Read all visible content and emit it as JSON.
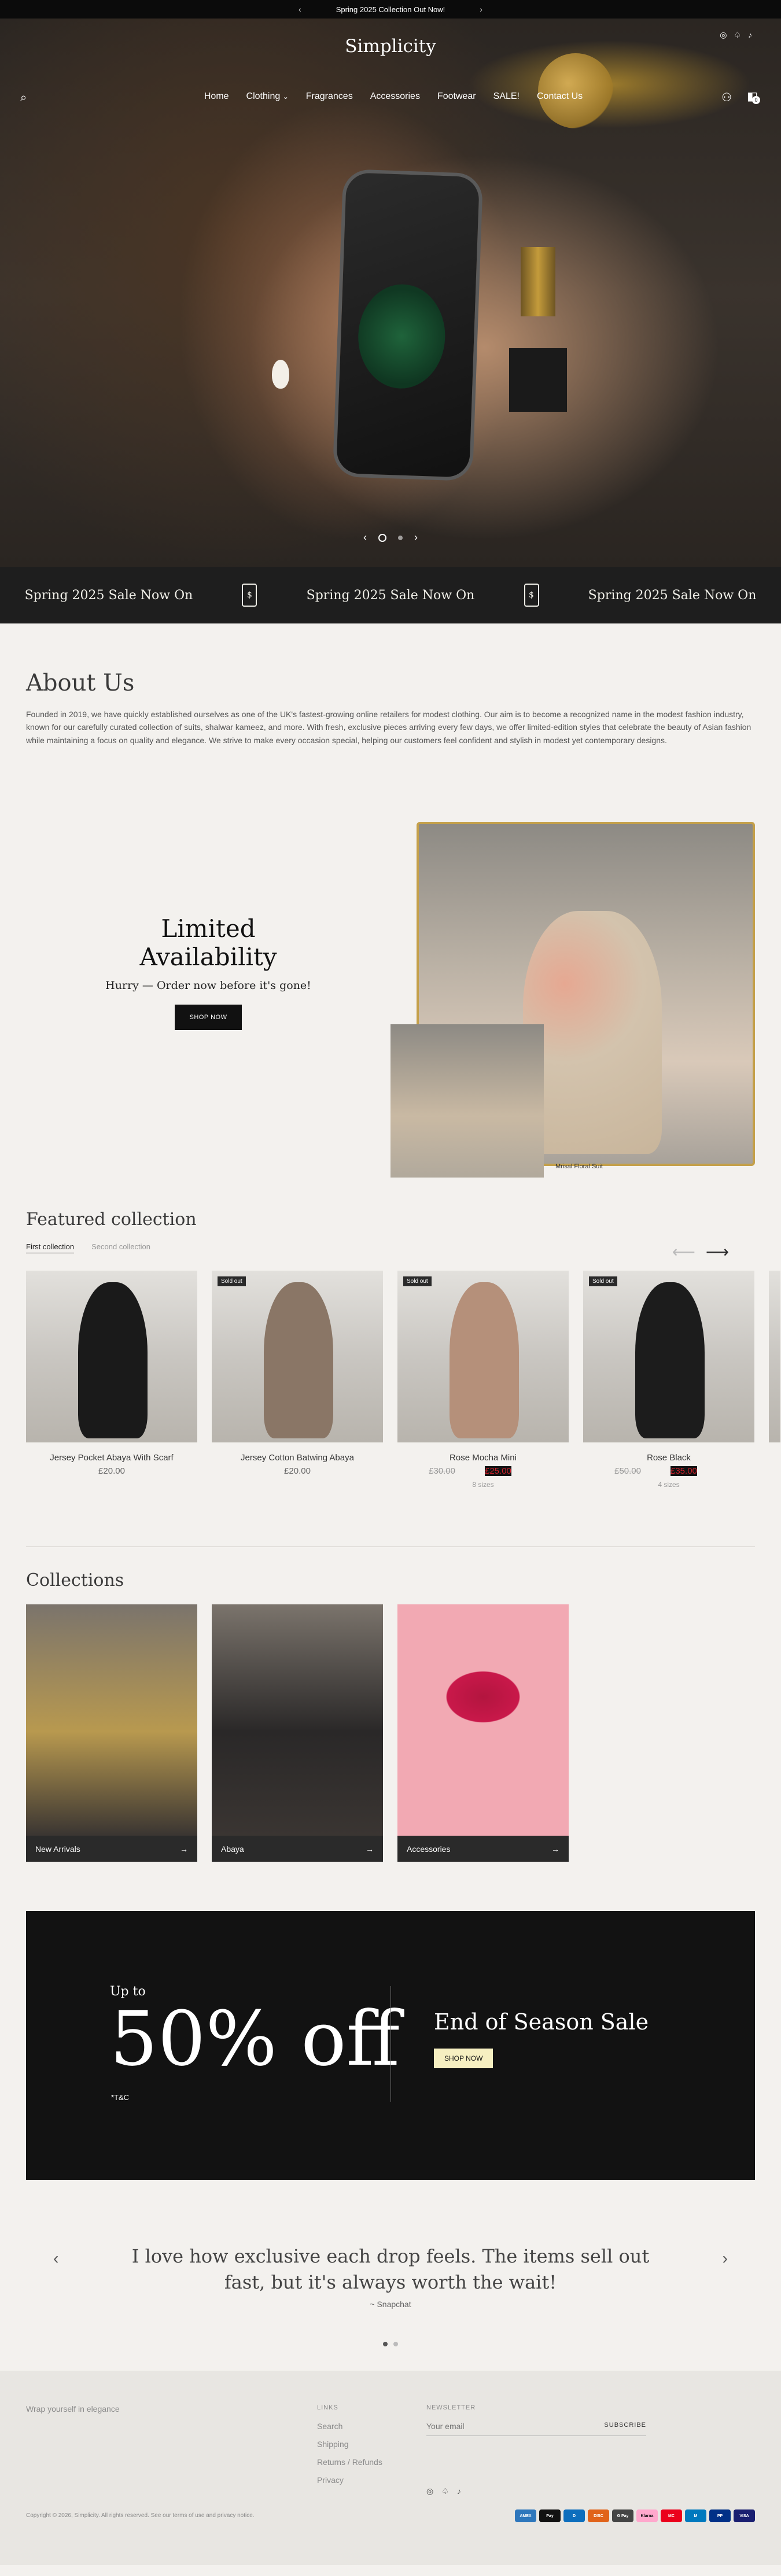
{
  "announcement": {
    "text": "Spring 2025 Collection Out Now!",
    "prev": "‹",
    "next": "›"
  },
  "header": {
    "logo": "Simplicity",
    "nav": [
      "Home",
      "Clothing",
      "Fragrances",
      "Accessories",
      "Footwear",
      "SALE!",
      "Contact Us"
    ],
    "clothing_chevron": "⌄",
    "cart_count": "0",
    "social": [
      "instagram-icon",
      "snapchat-icon",
      "tiktok-icon"
    ]
  },
  "hero": {
    "prev": "‹",
    "next": "›"
  },
  "marquee": {
    "text": "Spring 2025 Sale Now On",
    "tag_symbol": "$"
  },
  "about": {
    "title": "About Us",
    "body": "Founded in 2019, we have quickly established ourselves as one of the UK's fastest-growing online retailers for modest clothing. Our aim is to become a recognized name in the modest fashion industry, known for our carefully curated collection of suits, shalwar kameez, and more. With fresh, exclusive pieces arriving every few days, we offer limited-edition styles that celebrate the beauty of Asian fashion while maintaining a focus on quality and elegance. We strive to make every occasion special, helping our customers feel confident and stylish in modest yet contemporary designs."
  },
  "limited": {
    "title": "Limited Availability",
    "subtitle": "Hurry — Order now before it's gone!",
    "button": "SHOP NOW",
    "caption": "Mrisal Floral Suit"
  },
  "featured": {
    "title": "Featured collection",
    "tabs": [
      "First collection",
      "Second collection"
    ],
    "products": [
      {
        "name": "Jersey Pocket Abaya With Scarf",
        "price": "£20.00",
        "old_price": "",
        "sale_price": "",
        "badge": "",
        "sizes": "",
        "color": "#1a1a1a"
      },
      {
        "name": "Jersey Cotton Batwing Abaya",
        "price": "£20.00",
        "old_price": "",
        "sale_price": "",
        "badge": "Sold out",
        "sizes": "",
        "color": "#8a7666"
      },
      {
        "name": "Rose Mocha Mini",
        "price": "",
        "old_price": "£30.00",
        "sale_price": "£25.00",
        "badge": "Sold out",
        "sizes": "8 sizes",
        "color": "#b5907a"
      },
      {
        "name": "Rose Black",
        "price": "",
        "old_price": "£50.00",
        "sale_price": "£35.00",
        "badge": "Sold out",
        "sizes": "4 sizes",
        "color": "#1c1c1c"
      }
    ]
  },
  "collections": {
    "title": "Collections",
    "items": [
      {
        "label": "New Arrivals",
        "color": "#b8994f"
      },
      {
        "label": "Abaya",
        "color": "#2a2828"
      },
      {
        "label": "Accessories",
        "color": "#f2a9b3"
      }
    ]
  },
  "sale_banner": {
    "up_to": "Up to",
    "percent": "50% off",
    "tc": "*T&C",
    "title": "End of Season Sale",
    "button": "SHOP NOW"
  },
  "testimonial": {
    "quote": "I love how exclusive each drop feels. The items sell out fast, but it's always worth the wait!",
    "author": "~ Snapchat"
  },
  "footer": {
    "tagline": "Wrap yourself in elegance",
    "links_title": "LINKS",
    "links": [
      "Search",
      "Shipping",
      "Returns / Refunds",
      "Privacy"
    ],
    "newsletter_title": "NEWSLETTER",
    "email_placeholder": "Your email",
    "subscribe": "SUBSCRIBE",
    "copyright": "Copyright © 2026, Simplicity. All rights reserved. See our terms of use and privacy notice.",
    "payments": [
      "AMEX",
      "Pay",
      "D",
      "DISC",
      "G Pay",
      "Klarna",
      "MC",
      "M",
      "PP",
      "VISA"
    ]
  },
  "colors": {
    "accent_black": "#111111",
    "sale_red": "#d0212b",
    "yellow_button": "#f6efc1",
    "klarna_pink": "#ffa8cd"
  }
}
